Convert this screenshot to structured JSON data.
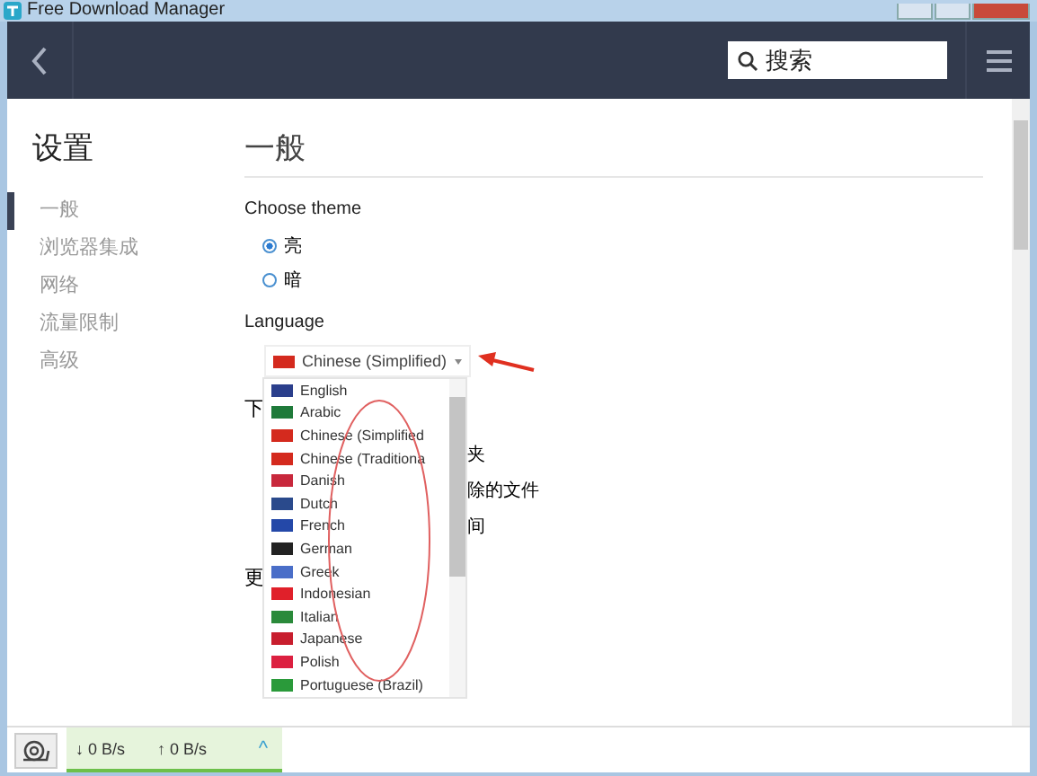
{
  "window": {
    "title": "Free Download Manager"
  },
  "toolbar": {
    "search": {
      "placeholder": "搜索"
    }
  },
  "sidebar": {
    "title": "设置",
    "items": [
      {
        "label": "一般",
        "selected": true
      },
      {
        "label": "浏览器集成",
        "selected": false
      },
      {
        "label": "网络",
        "selected": false
      },
      {
        "label": "流量限制",
        "selected": false
      },
      {
        "label": "高级",
        "selected": false
      }
    ]
  },
  "main": {
    "heading": "一般",
    "theme": {
      "label": "Choose theme",
      "options": [
        {
          "label": "亮",
          "selected": true
        },
        {
          "label": "暗",
          "selected": false
        }
      ]
    },
    "language": {
      "label": "Language",
      "value": "Chinese (Simplified)",
      "options": [
        {
          "label": "English",
          "color": "#2b3f8c"
        },
        {
          "label": "Arabic",
          "color": "#1f7a3a"
        },
        {
          "label": "Chinese (Simplified",
          "color": "#d42a1e"
        },
        {
          "label": "Chinese (Traditiona",
          "color": "#d42a1e"
        },
        {
          "label": "Danish",
          "color": "#c8283c"
        },
        {
          "label": "Dutch",
          "color": "#2a4a8c"
        },
        {
          "label": "French",
          "color": "#2448a8"
        },
        {
          "label": "German",
          "color": "#222222"
        },
        {
          "label": "Greek",
          "color": "#4a6ec8"
        },
        {
          "label": "Indonesian",
          "color": "#e0202a"
        },
        {
          "label": "Italian",
          "color": "#2a8a3a"
        },
        {
          "label": "Japanese",
          "color": "#c81e2e"
        },
        {
          "label": "Polish",
          "color": "#dc2040"
        },
        {
          "label": "Portuguese (Brazil)",
          "color": "#2a9a3a"
        }
      ]
    },
    "behind_texts": {
      "heading_download": "下",
      "rows": [
        "夹",
        "除的文件",
        "间"
      ],
      "heading_update": "更"
    }
  },
  "status_bar": {
    "download": "↓ 0 B/s",
    "upload": "↑ 0 B/s",
    "expander": "^"
  }
}
